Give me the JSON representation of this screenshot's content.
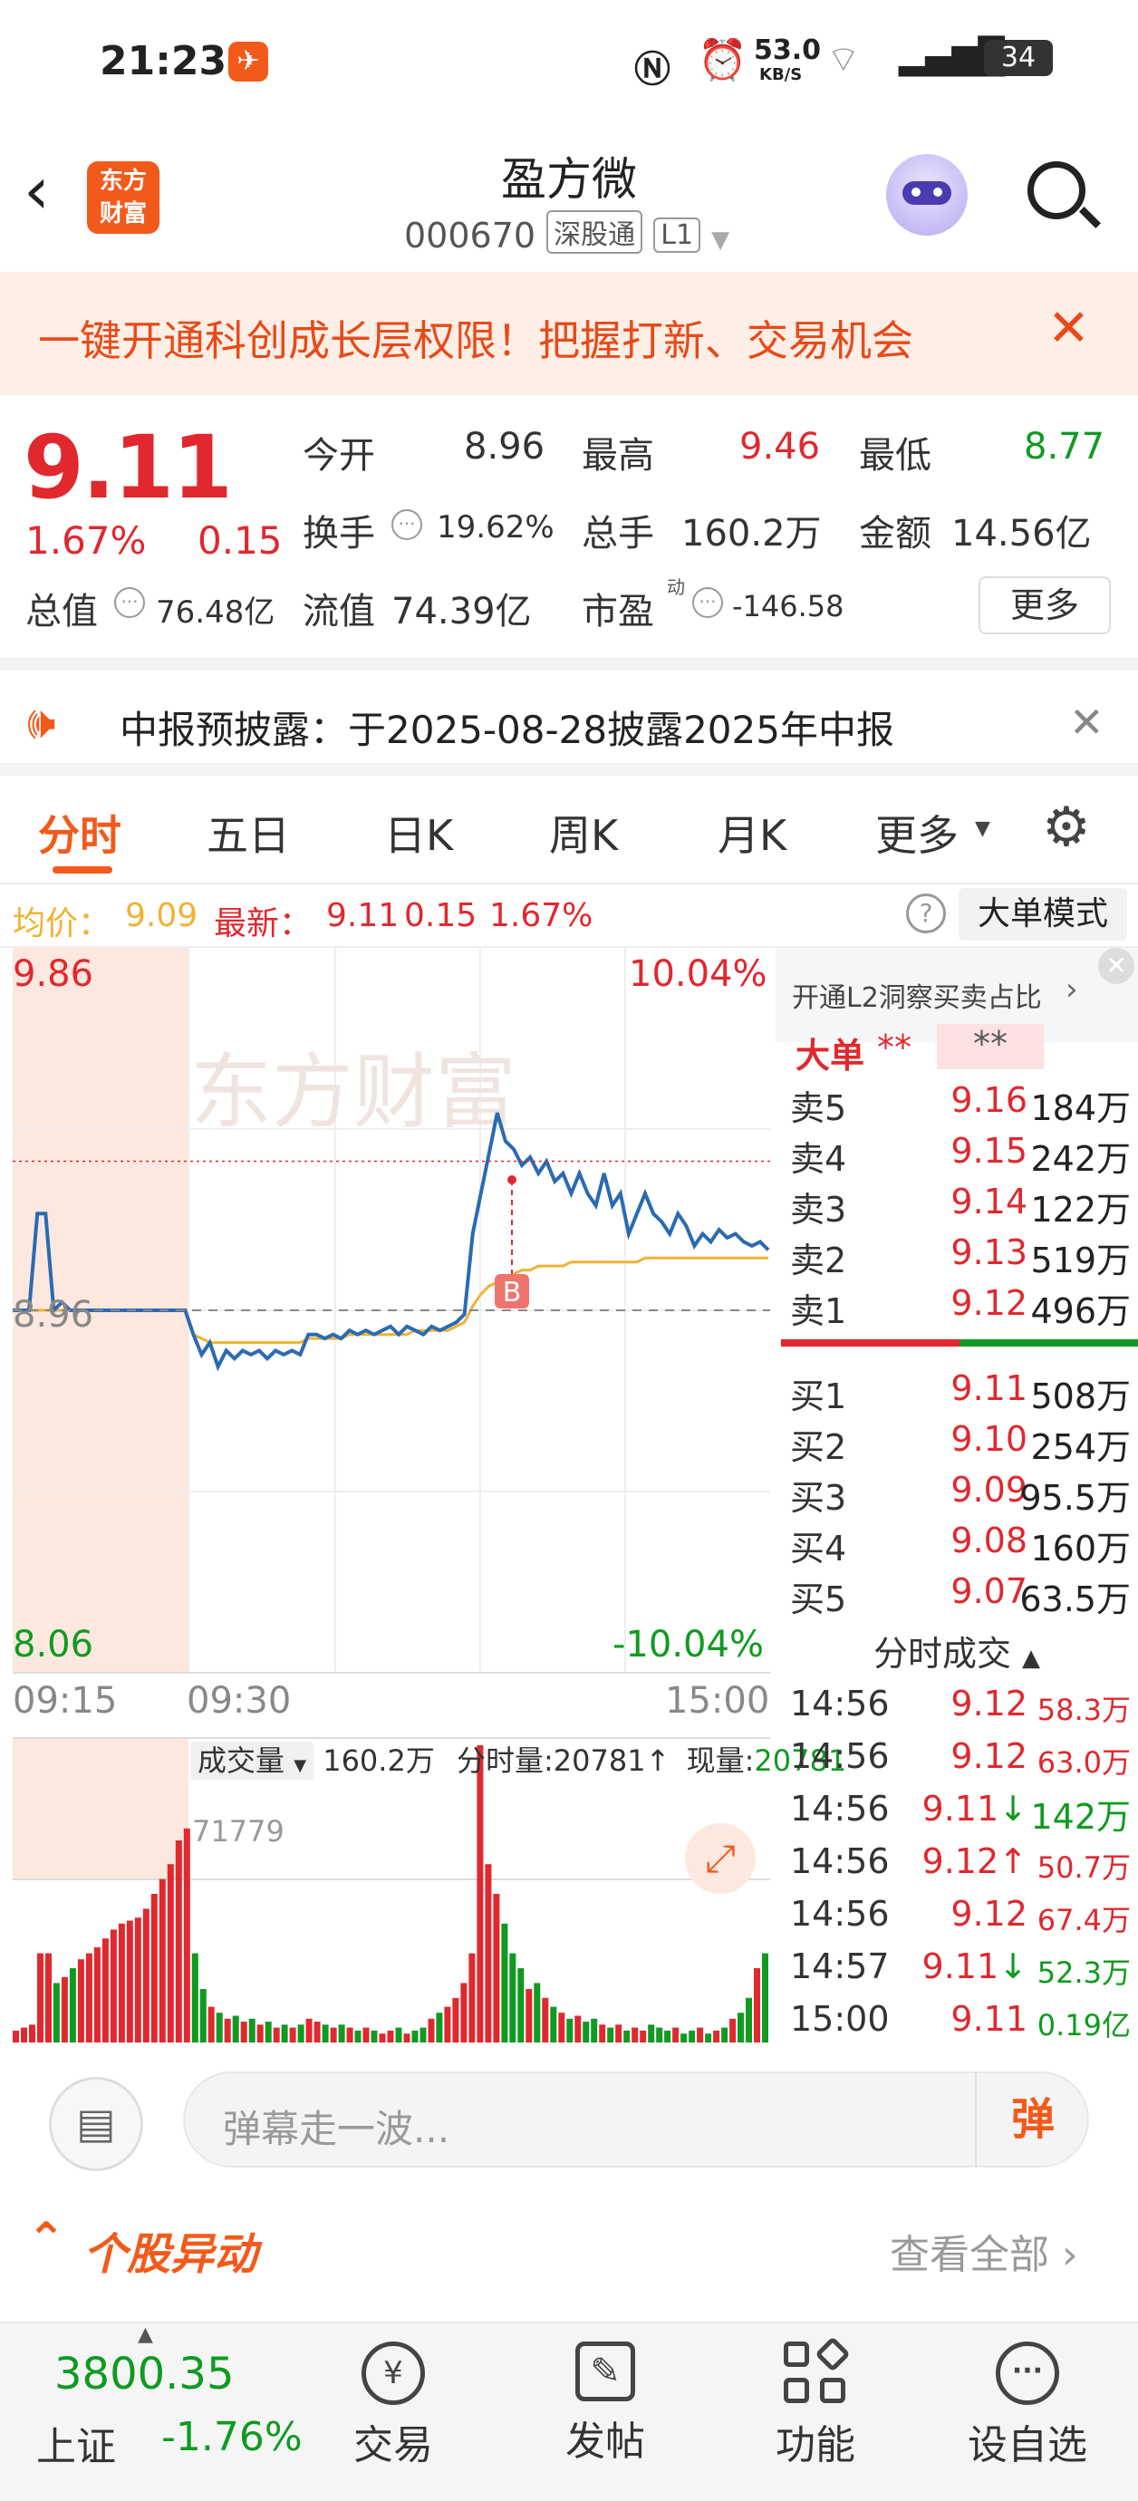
{
  "status_bar": {
    "time": "21:23",
    "net_speed": "53.0",
    "net_unit": "KB/S",
    "battery": "34"
  },
  "header": {
    "brand_top": "东方",
    "brand_bottom": "财富",
    "stock_name": "盈方微",
    "stock_code": "000670",
    "tag_connect": "深股通",
    "tag_level": "L1"
  },
  "banner": {
    "text": "一键开通科创成长层权限！把握打新、交易机会"
  },
  "quote": {
    "price": "9.11",
    "change_pct": "1.67%",
    "change": "0.15",
    "open_label": "今开",
    "open": "8.96",
    "high_label": "最高",
    "high": "9.46",
    "low_label": "最低",
    "low": "8.77",
    "turnover_label": "换手",
    "turnover": "19.62%",
    "volume_label": "总手",
    "volume": "160.2万",
    "amount_label": "金额",
    "amount": "14.56亿",
    "mktcap_label": "总值",
    "mktcap": "76.48亿",
    "float_label": "流值",
    "float": "74.39亿",
    "pe_label": "市盈",
    "pe_sup": "动",
    "pe": "-146.58",
    "more_button": "更多"
  },
  "notice": {
    "text": "中报预披露：于2025-08-28披露2025年中报"
  },
  "tabs": [
    "分时",
    "五日",
    "日K",
    "周K",
    "月K",
    "更多"
  ],
  "avg_bar": {
    "avg_label": "均价：",
    "avg": "9.09",
    "latest_label": "最新：",
    "latest": "9.11",
    "chg": "0.15",
    "pct": "1.67%",
    "mode_button": "大单模式"
  },
  "chart": {
    "y_top": "9.86",
    "y_mid": "8.96",
    "y_bottom": "8.06",
    "pct_top": "10.04%",
    "pct_bottom": "-10.04%",
    "t_start": "09:15",
    "t_open": "09:30",
    "t_end": "15:00",
    "vol_selector": "成交量",
    "vol_total": "160.2万",
    "minute_vol_label": "分时量:",
    "minute_vol": "20781",
    "now_vol_label": "现量:",
    "now_vol": "20781",
    "vol_max": "71779",
    "marker": "B",
    "watermark": "东方财富"
  },
  "chart_data": {
    "type": "line",
    "title": "",
    "xlabel": "",
    "ylabel": "",
    "ylim": [
      8.06,
      9.86
    ],
    "x_ticks": [
      "09:15",
      "09:30",
      "15:00"
    ],
    "prev_close": 8.96,
    "series": [
      {
        "values": [
          8.96,
          8.96,
          8.96,
          9.2,
          9.2,
          8.96,
          8.98,
          8.96,
          8.96,
          8.96,
          8.96,
          8.96,
          8.96,
          8.96,
          8.96,
          8.96,
          8.96,
          8.96,
          8.96,
          8.96,
          8.96,
          8.96,
          8.9,
          8.85,
          8.88,
          8.82,
          8.86,
          8.84,
          8.86,
          8.85,
          8.86,
          8.84,
          8.86,
          8.85,
          8.86,
          8.85,
          8.9,
          8.9,
          8.89,
          8.9,
          8.89,
          8.91,
          8.9,
          8.91,
          8.9,
          8.91,
          8.92,
          8.9,
          8.92,
          8.91,
          8.9,
          8.92,
          8.91,
          8.92,
          8.93,
          8.95,
          9.15,
          9.25,
          9.35,
          9.45,
          9.38,
          9.36,
          9.32,
          9.34,
          9.3,
          9.33,
          9.28,
          9.3,
          9.25,
          9.3,
          9.25,
          9.22,
          9.3,
          9.22,
          9.25,
          9.15,
          9.2,
          9.25,
          9.2,
          9.18,
          9.15,
          9.2,
          9.17,
          9.12,
          9.15,
          9.13,
          9.16,
          9.14,
          9.15,
          9.13,
          9.12,
          9.13,
          9.11
        ]
      },
      {
        "values": [
          8.96,
          8.96,
          8.96,
          8.96,
          8.96,
          8.96,
          8.96,
          8.96,
          8.96,
          8.96,
          8.96,
          8.96,
          8.96,
          8.96,
          8.96,
          8.96,
          8.96,
          8.96,
          8.96,
          8.96,
          8.96,
          8.96,
          8.9,
          8.89,
          8.88,
          8.88,
          8.88,
          8.88,
          8.88,
          8.88,
          8.88,
          8.88,
          8.88,
          8.88,
          8.88,
          8.88,
          8.89,
          8.89,
          8.89,
          8.89,
          8.89,
          8.9,
          8.9,
          8.9,
          8.9,
          8.9,
          8.9,
          8.9,
          8.9,
          8.91,
          8.91,
          8.91,
          8.91,
          8.91,
          8.92,
          8.93,
          8.97,
          9.0,
          9.02,
          9.03,
          9.04,
          9.05,
          9.06,
          9.06,
          9.07,
          9.07,
          9.07,
          9.07,
          9.08,
          9.08,
          9.08,
          9.08,
          9.08,
          9.08,
          9.08,
          9.08,
          9.08,
          9.09,
          9.09,
          9.09,
          9.09,
          9.09,
          9.09,
          9.09,
          9.09,
          9.09,
          9.09,
          9.09,
          9.09,
          9.09,
          9.09,
          9.09,
          9.09
        ]
      }
    ],
    "volume": [
      4,
      5,
      6,
      30,
      30,
      20,
      22,
      25,
      28,
      30,
      32,
      35,
      38,
      40,
      41,
      42,
      45,
      50,
      55,
      60,
      68,
      72,
      30,
      18,
      12,
      10,
      8,
      9,
      7,
      8,
      6,
      7,
      5,
      6,
      5,
      6,
      8,
      7,
      6,
      5,
      6,
      5,
      4,
      5,
      4,
      3,
      4,
      5,
      3,
      4,
      5,
      8,
      10,
      12,
      15,
      20,
      30,
      100,
      60,
      50,
      40,
      30,
      25,
      18,
      20,
      15,
      12,
      10,
      8,
      9,
      7,
      8,
      6,
      5,
      6,
      4,
      5,
      4,
      6,
      5,
      4,
      5,
      3,
      4,
      5,
      3,
      4,
      5,
      8,
      10,
      15,
      25,
      30
    ]
  },
  "orderbook": {
    "promo": "开通L2洞察买卖占比",
    "big_label": "大单",
    "big_mask_left": "**",
    "big_mask_right": "**",
    "asks": [
      {
        "label": "卖5",
        "price": "9.16",
        "vol": "184万"
      },
      {
        "label": "卖4",
        "price": "9.15",
        "vol": "242万"
      },
      {
        "label": "卖3",
        "price": "9.14",
        "vol": "122万"
      },
      {
        "label": "卖2",
        "price": "9.13",
        "vol": "519万"
      },
      {
        "label": "卖1",
        "price": "9.12",
        "vol": "496万"
      }
    ],
    "bids": [
      {
        "label": "买1",
        "price": "9.11",
        "vol": "508万"
      },
      {
        "label": "买2",
        "price": "9.10",
        "vol": "254万"
      },
      {
        "label": "买3",
        "price": "9.09",
        "vol": "95.5万"
      },
      {
        "label": "买4",
        "price": "9.08",
        "vol": "160万"
      },
      {
        "label": "买5",
        "price": "9.07",
        "vol": "63.5万"
      }
    ],
    "ticks_title": "分时成交",
    "ticks": [
      {
        "time": "14:56",
        "price": "9.12",
        "arrow": "",
        "vol": "58.3万",
        "color": "#e0282e"
      },
      {
        "time": "14:56",
        "price": "9.12",
        "arrow": "",
        "vol": "63.0万",
        "color": "#e0282e"
      },
      {
        "time": "14:56",
        "price": "9.11",
        "arrow": "↓",
        "vol": "142万",
        "color": "#109a21"
      },
      {
        "time": "14:56",
        "price": "9.12",
        "arrow": "↑",
        "vol": "50.7万",
        "color": "#e0282e"
      },
      {
        "time": "14:56",
        "price": "9.12",
        "arrow": "",
        "vol": "67.4万",
        "color": "#e0282e"
      },
      {
        "time": "14:57",
        "price": "9.11",
        "arrow": "↓",
        "vol": "52.3万",
        "color": "#109a21"
      },
      {
        "time": "15:00",
        "price": "9.11",
        "arrow": "",
        "vol": "0.19亿",
        "color": "#109a21"
      }
    ]
  },
  "danmu": {
    "placeholder": "弹幕走一波...",
    "send": "弹",
    "section_title": "个股异动",
    "view_all": "查看全部"
  },
  "bottom_nav": {
    "index_value": "3800.35",
    "index_name": "上证",
    "index_pct": "-1.76%",
    "items": [
      {
        "label": "交易"
      },
      {
        "label": "发帖"
      },
      {
        "label": "功能"
      },
      {
        "label": "设自选"
      }
    ]
  },
  "colors": {
    "red": "#e0282e",
    "green": "#109a21",
    "orange": "#f25a1b",
    "line_blue": "#2a6ab3",
    "avg_yellow": "#f0b233"
  }
}
